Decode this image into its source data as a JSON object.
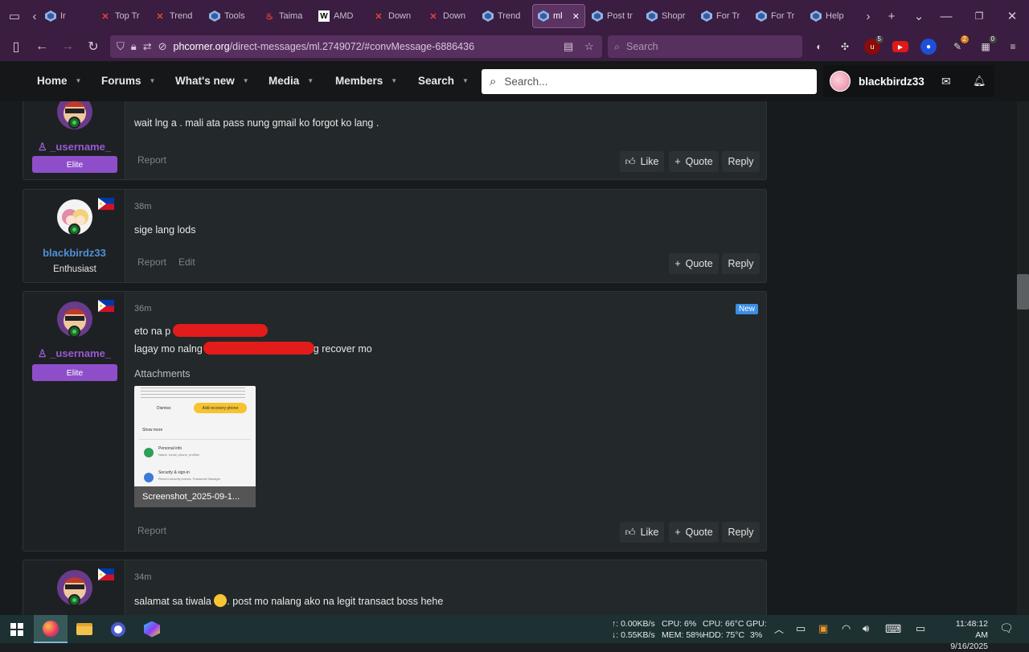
{
  "browser": {
    "tabs": [
      {
        "label": "Ir",
        "icon": "phcorner-icon"
      },
      {
        "label": "Top Tr",
        "icon": "x-icon"
      },
      {
        "label": "Trend",
        "icon": "x-icon"
      },
      {
        "label": "Tools",
        "icon": "phcorner-icon"
      },
      {
        "label": "Taima",
        "icon": "flame-icon"
      },
      {
        "label": "AMD",
        "icon": "wikipedia-icon"
      },
      {
        "label": "Down",
        "icon": "x-icon"
      },
      {
        "label": "Down",
        "icon": "x-icon"
      },
      {
        "label": "Trend",
        "icon": "phcorner-icon"
      },
      {
        "label": "ml",
        "icon": "phcorner-icon",
        "active": true
      },
      {
        "label": "Post tr",
        "icon": "phcorner-icon"
      },
      {
        "label": "Shopr",
        "icon": "phcorner-icon"
      },
      {
        "label": "For Tr",
        "icon": "phcorner-icon"
      },
      {
        "label": "For Tr",
        "icon": "phcorner-icon"
      },
      {
        "label": "Help",
        "icon": "phcorner-icon"
      }
    ],
    "url_domain": "phcorner.org",
    "url_path": "/direct-messages/ml.2749072/#convMessage-6886436",
    "search_placeholder": "Search",
    "ext_badges": {
      "ublock": "5",
      "ext2": "2",
      "ext3": "0"
    }
  },
  "site": {
    "nav": [
      "Home",
      "Forums",
      "What's new",
      "Media",
      "Members",
      "Search"
    ],
    "search_placeholder": "Search...",
    "username": "blackbirdz33"
  },
  "messages": [
    {
      "user": "_username_",
      "role": "Elite",
      "text": "wait lng a . mali ata pass nung gmail ko forgot ko lang .",
      "report": "Report",
      "like": "Like",
      "quote": "Quote",
      "reply": "Reply"
    },
    {
      "time": "38m",
      "user": "blackbirdz33",
      "role": "Enthusiast",
      "text": "sige lang lods",
      "report": "Report",
      "edit": "Edit",
      "quote": "Quote",
      "reply": "Reply"
    },
    {
      "time": "36m",
      "user": "_username_",
      "role": "Elite",
      "badge": "New",
      "line1": "eto na p",
      "line2a": "lagay mo nalng",
      "line2b": "g recover mo",
      "attachments_label": "Attachments",
      "attachment_name": "Screenshot_2025-09-1...",
      "thumb_texts": [
        "Dismiss",
        "Add recovery phone",
        "Show more",
        "Personal info",
        "Name, email, phone, profiles",
        "Security & sign-in",
        "Recent security events, Password Manager"
      ],
      "report": "Report",
      "like": "Like",
      "quote": "Quote",
      "reply": "Reply"
    },
    {
      "time": "34m",
      "text_a": "salamat sa tiwala ",
      "text_b": ". post mo nalang ako na legit transact boss hehe"
    }
  ],
  "taskbar": {
    "net_up": "↑: 0.00KB/s",
    "net_down": "↓: 0.55KB/s",
    "cpu": "CPU: 6%",
    "mem": "MEM: 58%",
    "cpu_temp": "CPU: 66°C",
    "hdd_temp": "HDD: 75°C",
    "gpu_label": "GPU:",
    "gpu_val": "3%",
    "time": "11:48:12 AM",
    "date": "9/16/2025"
  }
}
